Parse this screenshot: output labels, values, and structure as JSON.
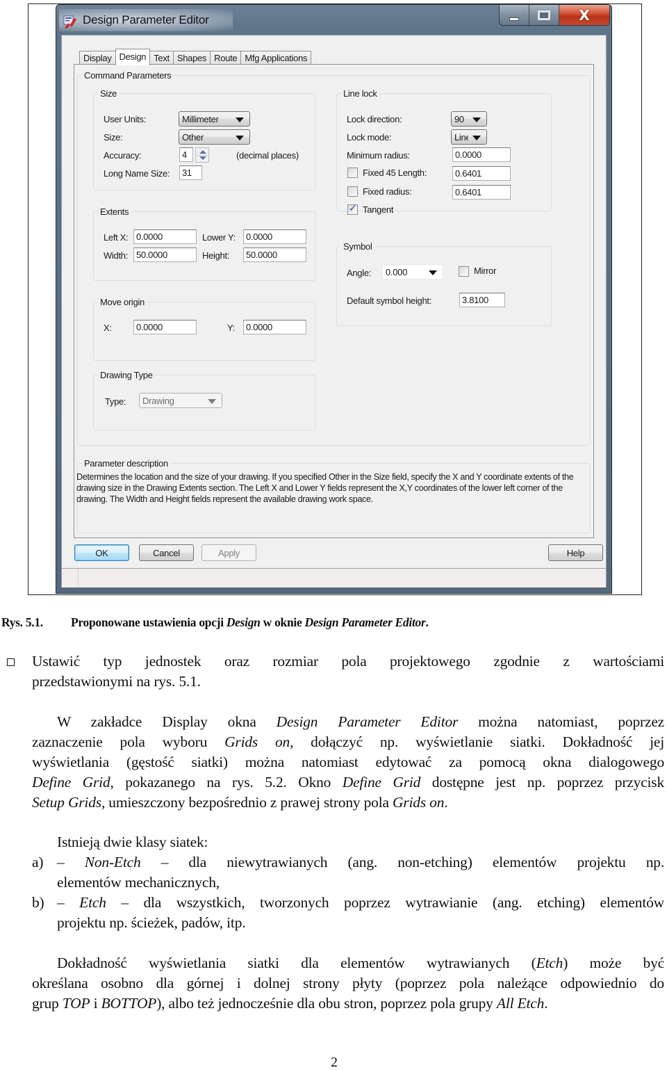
{
  "window": {
    "title": "Design Parameter Editor",
    "controls": {
      "minimize": "minimize",
      "maximize": "maximize",
      "close": "X"
    }
  },
  "tabs": [
    {
      "label": "Display",
      "active": false
    },
    {
      "label": "Design",
      "active": true
    },
    {
      "label": "Text",
      "active": false
    },
    {
      "label": "Shapes",
      "active": false
    },
    {
      "label": "Route",
      "active": false
    },
    {
      "label": "Mfg Applications",
      "active": false
    }
  ],
  "command_parameters": {
    "title": "Command Parameters",
    "size": {
      "title": "Size",
      "user_units_label": "User Units:",
      "user_units_value": "Millimeter",
      "size_label": "Size:",
      "size_value": "Other",
      "accuracy_label": "Accuracy:",
      "accuracy_value": "4",
      "accuracy_suffix": "(decimal places)",
      "long_name_label": "Long Name Size:",
      "long_name_value": "31"
    },
    "extents": {
      "title": "Extents",
      "left_x_label": "Left X:",
      "left_x_value": "0.0000",
      "lower_y_label": "Lower Y:",
      "lower_y_value": "0.0000",
      "width_label": "Width:",
      "width_value": "50.0000",
      "height_label": "Height:",
      "height_value": "50.0000"
    },
    "move_origin": {
      "title": "Move origin",
      "x_label": "X:",
      "x_value": "0.0000",
      "y_label": "Y:",
      "y_value": "0.0000"
    },
    "drawing_type": {
      "title": "Drawing Type",
      "type_label": "Type:",
      "type_value": "Drawing"
    },
    "line_lock": {
      "title": "Line lock",
      "lock_direction_label": "Lock direction:",
      "lock_direction_value": "90",
      "lock_mode_label": "Lock mode:",
      "lock_mode_value": "Line",
      "min_radius_label": "Minimum radius:",
      "min_radius_value": "0.0000",
      "fixed45_label": "Fixed 45 Length:",
      "fixed45_checked": false,
      "fixed45_value": "0.6401",
      "fixed_radius_label": "Fixed radius:",
      "fixed_radius_checked": false,
      "fixed_radius_value": "0.6401",
      "tangent_label": "Tangent",
      "tangent_checked": true
    },
    "symbol": {
      "title": "Symbol",
      "angle_label": "Angle:",
      "angle_value": "0.000",
      "mirror_label": "Mirror",
      "mirror_checked": false,
      "default_height_label": "Default symbol height:",
      "default_height_value": "3.8100"
    }
  },
  "parameter_description": {
    "title": "Parameter description",
    "text": "Determines the location and the size of your drawing.  If you specified Other in the Size field, specify the X and Y coordinate extents of the drawing size in the Drawing Extents section. The Left X and Lower Y fields represent the X,Y coordinates of the lower left corner of the drawing.  The Width and Height fields represent the available drawing work space."
  },
  "buttons": {
    "ok": "OK",
    "cancel": "Cancel",
    "apply": "Apply",
    "help": "Help"
  },
  "document": {
    "caption_number": "Rys. 5.1.",
    "caption_parts": [
      "Proponowane ustawienia opcji ",
      "Design",
      " w oknie ",
      "Design Parameter Editor",
      "."
    ],
    "bullet": {
      "line1": "Ustawić typ jednostek oraz rozmiar pola projektowego zgodnie z wartościami",
      "line2": "przedstawionymi na rys. 5.1."
    },
    "para1": {
      "l1a": "W zakładce Display okna ",
      "l1b": "Design Parameter Editor",
      "l1c": " można natomiast, poprzez",
      "l2a": "zaznaczenie pola wyboru ",
      "l2b": "Grids on",
      "l2c": ", dołączyć np. wyświetlanie siatki. Dokładność jej",
      "l3": "wyświetlania (gęstość siatki) można natomiast edytować za pomocą okna dialogowego",
      "l4a": "Define Grid",
      "l4b": ", pokazanego na rys. 5.2. Okno ",
      "l4c": "Define Grid",
      "l4d": " dostępne jest np. poprzez przycisk",
      "l5a": "Setup Grids",
      "l5b": ",  umieszczony bezpośrednio z prawej strony pola ",
      "l5c": "Grids on",
      "l5d": "."
    },
    "grid_classes": {
      "intro": "Istnieją dwie klasy siatek:",
      "a_marker": "a)",
      "a_dash1": "–",
      "a_term": "Non-Etch",
      "a_rest1": "– dla niewytrawianych (ang. non-etching) elementów projektu np.",
      "a_rest2": "elementów mechanicznych,",
      "b_marker": "b)",
      "b_dash1": "–",
      "b_term": "Etch",
      "b_rest1": "– dla wszystkich, tworzonych poprzez wytrawianie (ang. etching) elementów",
      "b_rest2": "projektu np. ścieżek, padów, itp."
    },
    "para2": {
      "l1a": "Dokładność wyświetlania siatki dla elementów wytrawianych (",
      "l1b": "Etch",
      "l1c": ") może być",
      "l2": "określana osobno dla górnej i dolnej strony płyty (poprzez pola należące odpowiednio do",
      "l3a": "grup ",
      "l3b": "TOP",
      "l3c": " i ",
      "l3d": "BOTTOP",
      "l3e": "), albo też jednocześnie dla obu stron, poprzez pola grupy ",
      "l3f": "All Etch",
      "l3g": "."
    },
    "page_number": "2"
  }
}
